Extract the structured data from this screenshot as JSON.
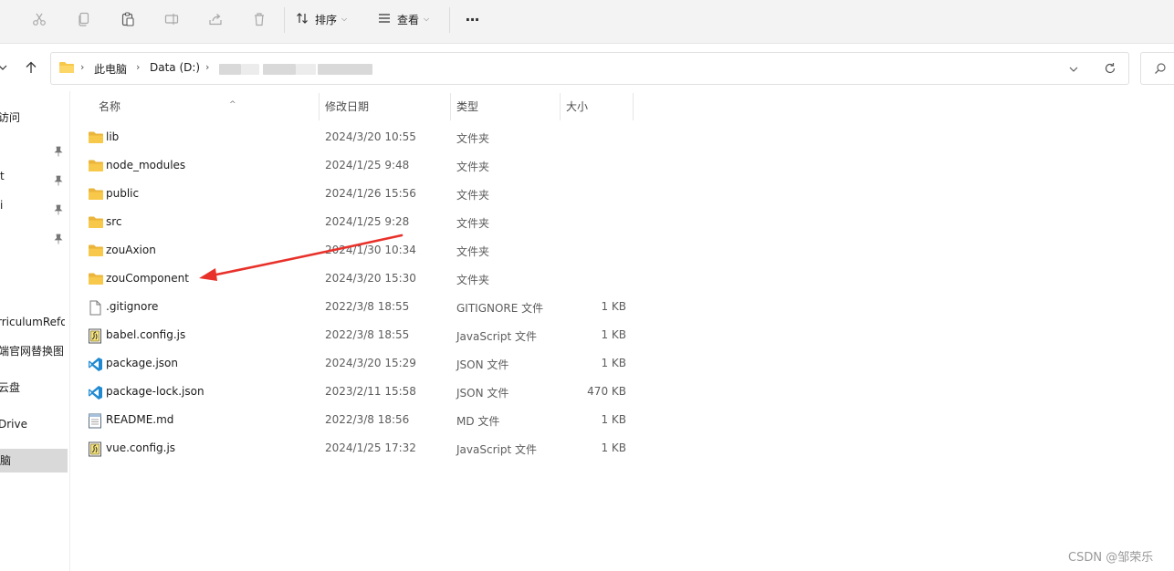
{
  "toolbar": {
    "cut_icon": "scissors-icon",
    "copy_icon": "copy-icon",
    "paste_icon": "paste-icon",
    "rename_icon": "rename-icon",
    "share_icon": "share-icon",
    "delete_icon": "trash-icon",
    "sort_label": "排序",
    "view_label": "查看",
    "more_label": "···"
  },
  "address": {
    "crumbs": [
      "此电脑",
      "Data (D:)"
    ]
  },
  "sidebar": {
    "items": [
      {
        "label": "访问"
      },
      {
        "label": ""
      },
      {
        "label": "t"
      },
      {
        "label": "i"
      },
      {
        "label": ""
      },
      {
        "label": "rriculumReform"
      },
      {
        "label": "端官网替换图"
      },
      {
        "label": "云盘"
      },
      {
        "label": "Drive"
      },
      {
        "label": "脑"
      }
    ]
  },
  "columns": {
    "name": "名称",
    "date": "修改日期",
    "type": "类型",
    "size": "大小"
  },
  "files": [
    {
      "name": "lib",
      "date": "2024/3/20 10:55",
      "type": "文件夹",
      "size": "",
      "icon": "folder-icon"
    },
    {
      "name": "node_modules",
      "date": "2024/1/25 9:48",
      "type": "文件夹",
      "size": "",
      "icon": "folder-icon"
    },
    {
      "name": "public",
      "date": "2024/1/26 15:56",
      "type": "文件夹",
      "size": "",
      "icon": "folder-icon"
    },
    {
      "name": "src",
      "date": "2024/1/25 9:28",
      "type": "文件夹",
      "size": "",
      "icon": "folder-icon"
    },
    {
      "name": "zouAxion",
      "date": "2024/1/30 10:34",
      "type": "文件夹",
      "size": "",
      "icon": "folder-icon"
    },
    {
      "name": "zouComponent",
      "date": "2024/3/20 15:30",
      "type": "文件夹",
      "size": "",
      "icon": "folder-icon"
    },
    {
      "name": ".gitignore",
      "date": "2022/3/8 18:55",
      "type": "GITIGNORE 文件",
      "size": "1 KB",
      "icon": "file-icon"
    },
    {
      "name": "babel.config.js",
      "date": "2022/3/8 18:55",
      "type": "JavaScript 文件",
      "size": "1 KB",
      "icon": "js-file-icon"
    },
    {
      "name": "package.json",
      "date": "2024/3/20 15:29",
      "type": "JSON 文件",
      "size": "1 KB",
      "icon": "vscode-icon"
    },
    {
      "name": "package-lock.json",
      "date": "2023/2/11 15:58",
      "type": "JSON 文件",
      "size": "470 KB",
      "icon": "vscode-icon"
    },
    {
      "name": "README.md",
      "date": "2022/3/8 18:56",
      "type": "MD 文件",
      "size": "1 KB",
      "icon": "text-file-icon"
    },
    {
      "name": "vue.config.js",
      "date": "2024/1/25 17:32",
      "type": "JavaScript 文件",
      "size": "1 KB",
      "icon": "js-file-icon"
    }
  ],
  "watermark": "CSDN @邹荣乐",
  "colors": {
    "folder": "#f8c84a",
    "arrow": "#e8312a",
    "selected": "#d9d9d9"
  }
}
